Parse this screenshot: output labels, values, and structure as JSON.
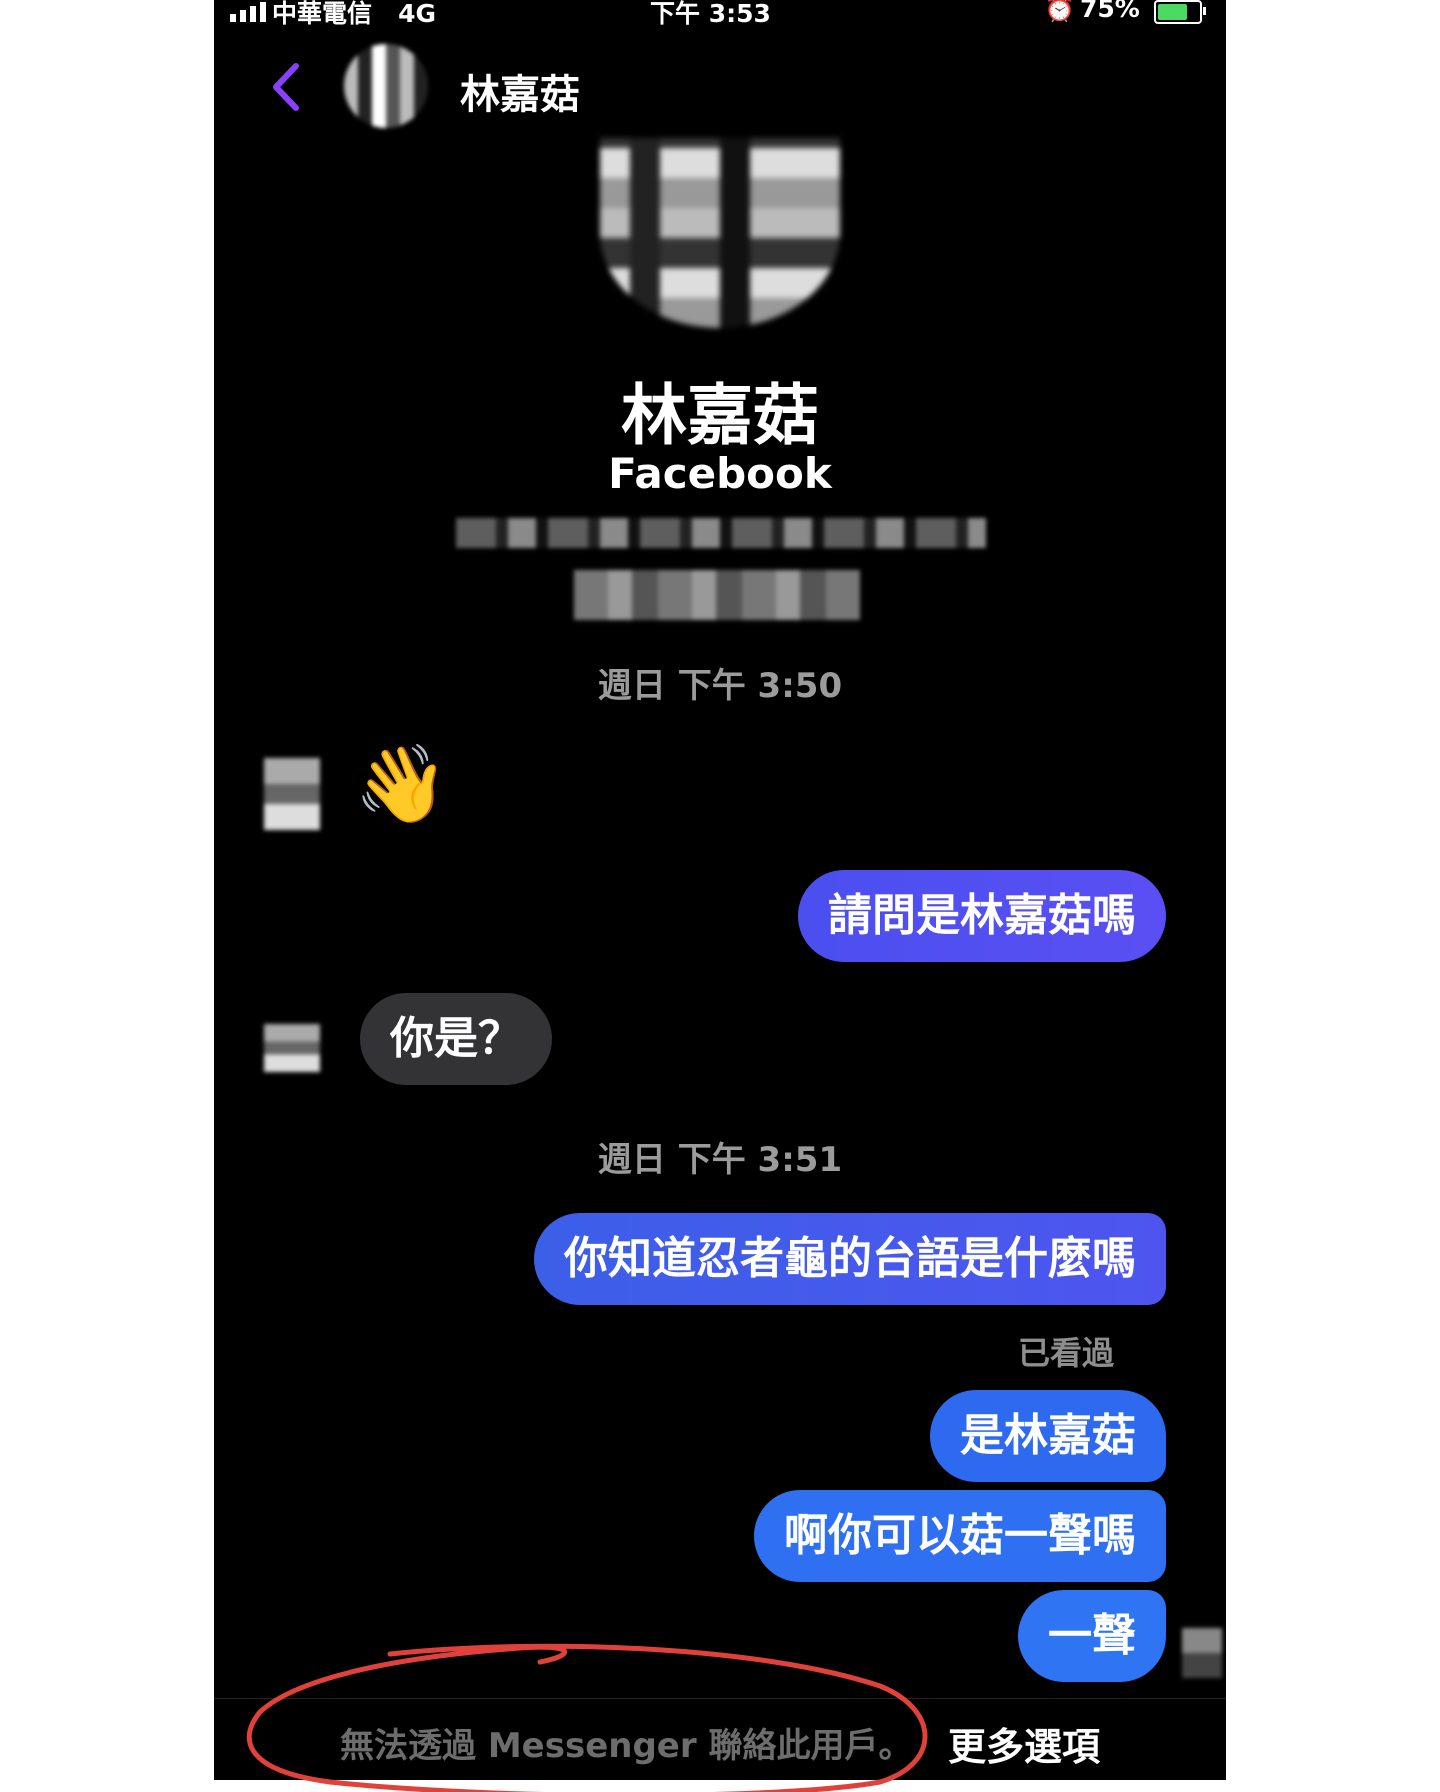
{
  "status_bar": {
    "carrier": "中華電信",
    "network": "4G",
    "time": "下午 3:53",
    "battery_percent": "75%",
    "battery_level": 0.75,
    "icons": [
      "signal-icon",
      "alarm-icon",
      "battery-icon"
    ]
  },
  "header": {
    "back_icon": "chevron-left-icon",
    "contact_name": "林嘉菇"
  },
  "profile": {
    "name": "林嘉菇",
    "platform": "Facebook"
  },
  "messages": {
    "timestamp_1": "週日 下午 3:50",
    "wave_emoji": "👋",
    "outgoing_1": "請問是林嘉菇嗎",
    "incoming_1": "你是？",
    "timestamp_2": "週日 下午 3:51",
    "outgoing_2": "你知道忍者龜的台語是什麼嗎",
    "seen_label": "已看過",
    "outgoing_3": "是林嘉菇",
    "outgoing_4": "啊你可以菇一聲嗎",
    "outgoing_5": "一聲"
  },
  "footer": {
    "notice": "無法透過 Messenger 聯絡此用戶。",
    "more_options": "更多選項"
  },
  "colors": {
    "background": "#000000",
    "accent": "#8a3ffc",
    "outgoing_bubble": "#2f70f2",
    "incoming_bubble": "#333336",
    "annotation": "#e0413a"
  }
}
